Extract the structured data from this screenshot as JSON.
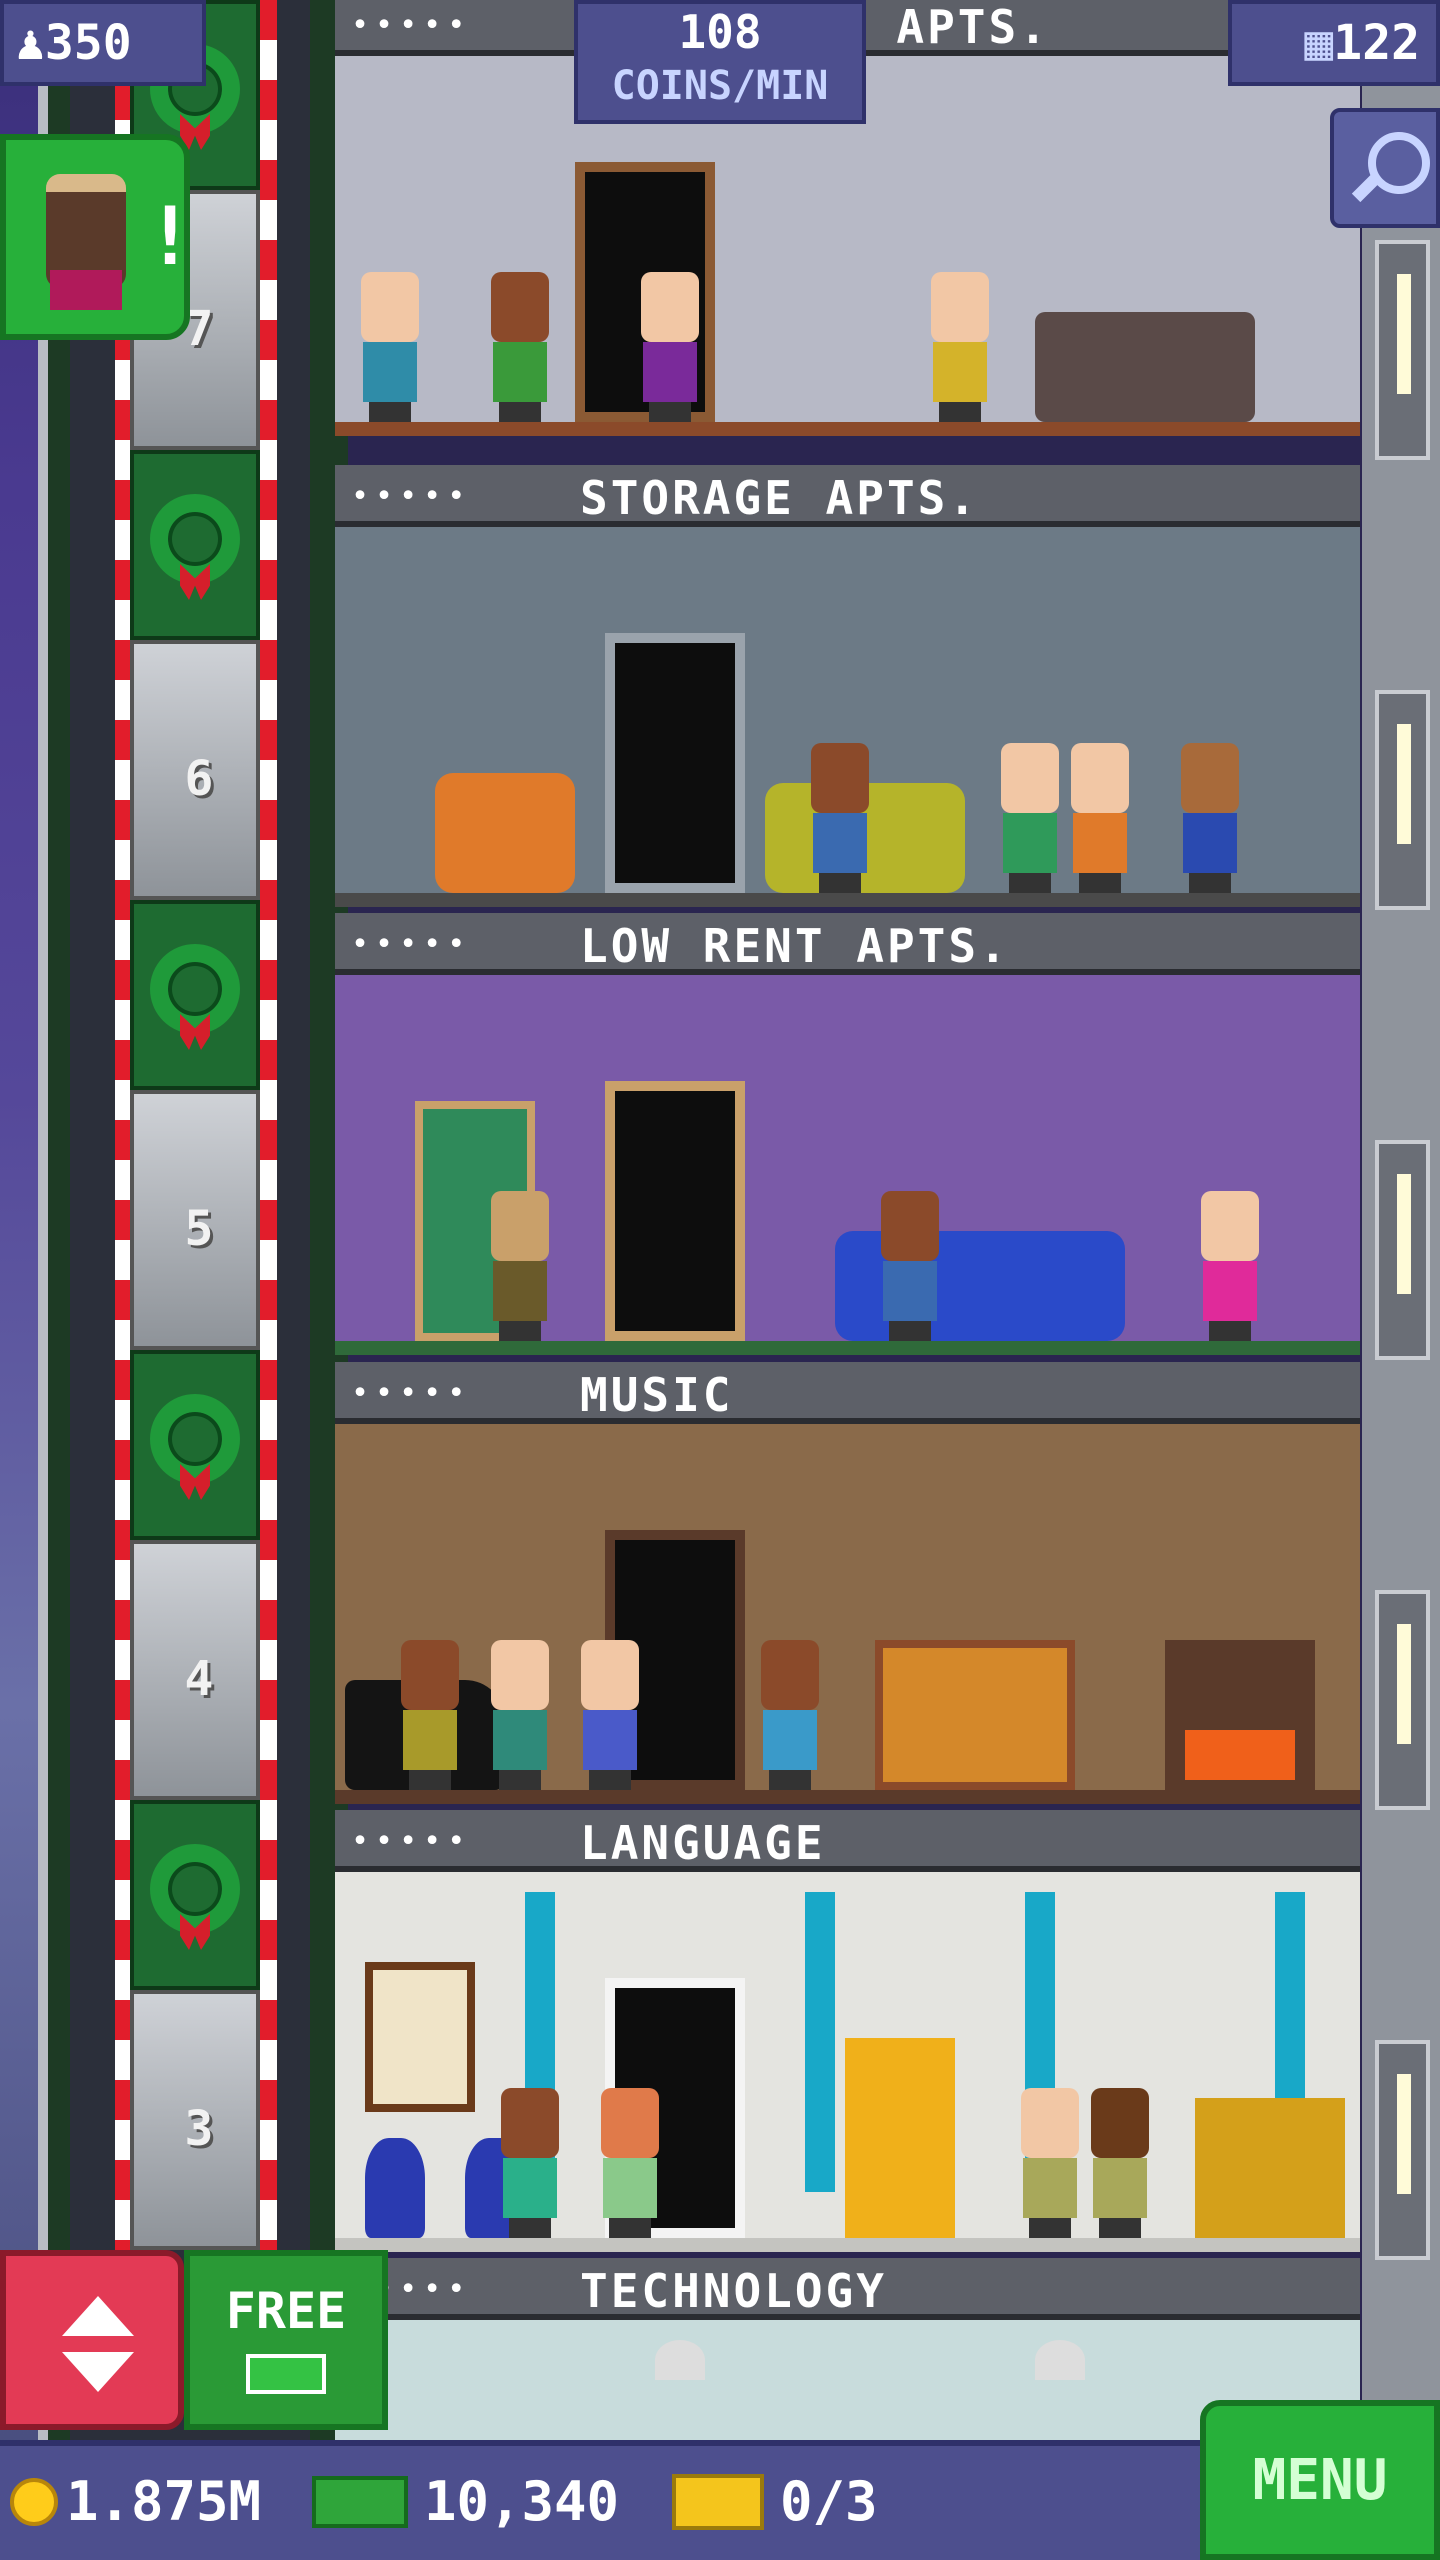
{
  "hud": {
    "population": "350",
    "coins_per_min_value": "108",
    "coins_per_min_unit": "COINS/MIN",
    "floors": "122"
  },
  "floors": [
    {
      "name": "& APTS.",
      "residents": "•••••"
    },
    {
      "name": "STORAGE APTS.",
      "residents": "•••••"
    },
    {
      "name": "LOW RENT APTS.",
      "residents": "•••••"
    },
    {
      "name": "MUSIC",
      "residents": "•••••"
    },
    {
      "name": "LANGUAGE",
      "residents": "•••••"
    },
    {
      "name": "TECHNOLOGY",
      "residents": "•••••"
    }
  ],
  "elevator_floor_numbers": [
    "7",
    "6",
    "5",
    "4",
    "3"
  ],
  "bottom": {
    "coins": "1.875M",
    "bux": "10,340",
    "tickets": "0/3",
    "menu_label": "MENU",
    "free_label": "FREE"
  },
  "colors": {
    "hud_bg": "#4d4f8e",
    "menu_green": "#27b03a",
    "elevator_red": "#e33a55"
  },
  "icons": [
    "population-icon",
    "floors-icon",
    "search-icon",
    "coin-icon",
    "bux-icon",
    "ticket-icon",
    "wreath-icon"
  ]
}
